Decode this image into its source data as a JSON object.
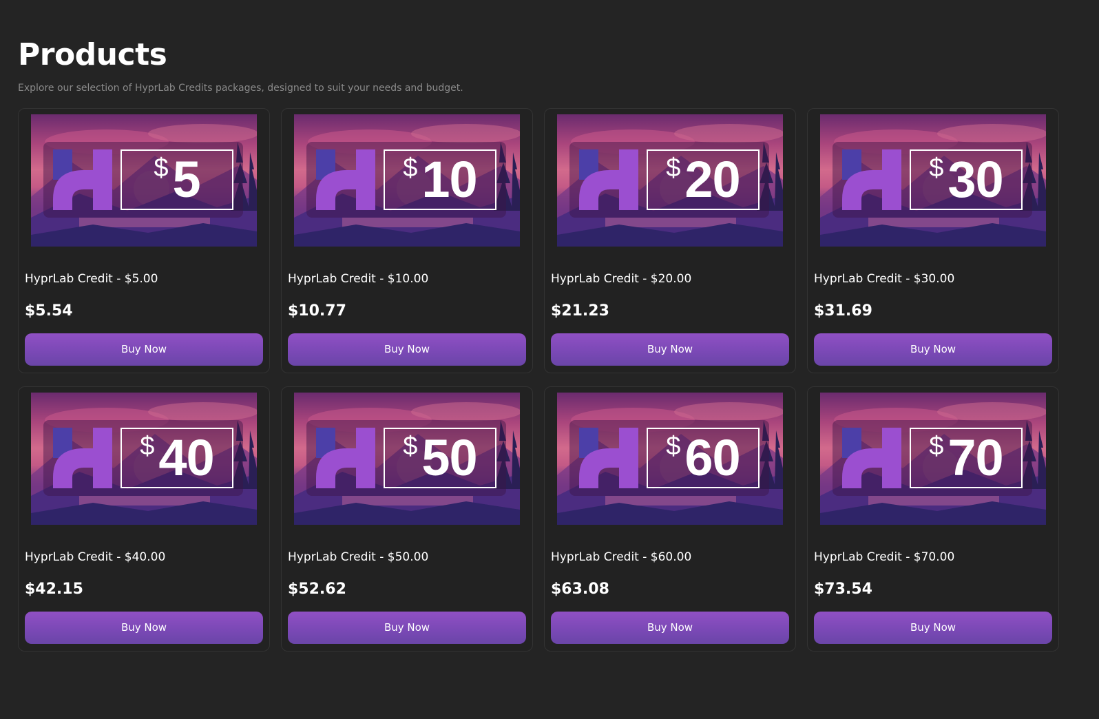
{
  "page": {
    "title": "Products",
    "subtitle": "Explore our selection of HyprLab Credits packages, designed to suit your needs and budget."
  },
  "colors": {
    "background": "#242424",
    "button": "#8a4fc2",
    "logo": "#9b4fd0",
    "logo_accent": "#4c3fa8"
  },
  "products": [
    {
      "image_currency": "$",
      "image_amount": "5",
      "name": "HyprLab Credit - $5.00",
      "price": "$5.54",
      "button": "Buy Now"
    },
    {
      "image_currency": "$",
      "image_amount": "10",
      "name": "HyprLab Credit - $10.00",
      "price": "$10.77",
      "button": "Buy Now"
    },
    {
      "image_currency": "$",
      "image_amount": "20",
      "name": "HyprLab Credit - $20.00",
      "price": "$21.23",
      "button": "Buy Now"
    },
    {
      "image_currency": "$",
      "image_amount": "30",
      "name": "HyprLab Credit - $30.00",
      "price": "$31.69",
      "button": "Buy Now"
    },
    {
      "image_currency": "$",
      "image_amount": "40",
      "name": "HyprLab Credit - $40.00",
      "price": "$42.15",
      "button": "Buy Now"
    },
    {
      "image_currency": "$",
      "image_amount": "50",
      "name": "HyprLab Credit - $50.00",
      "price": "$52.62",
      "button": "Buy Now"
    },
    {
      "image_currency": "$",
      "image_amount": "60",
      "name": "HyprLab Credit - $60.00",
      "price": "$63.08",
      "button": "Buy Now"
    },
    {
      "image_currency": "$",
      "image_amount": "70",
      "name": "HyprLab Credit - $70.00",
      "price": "$73.54",
      "button": "Buy Now"
    }
  ]
}
